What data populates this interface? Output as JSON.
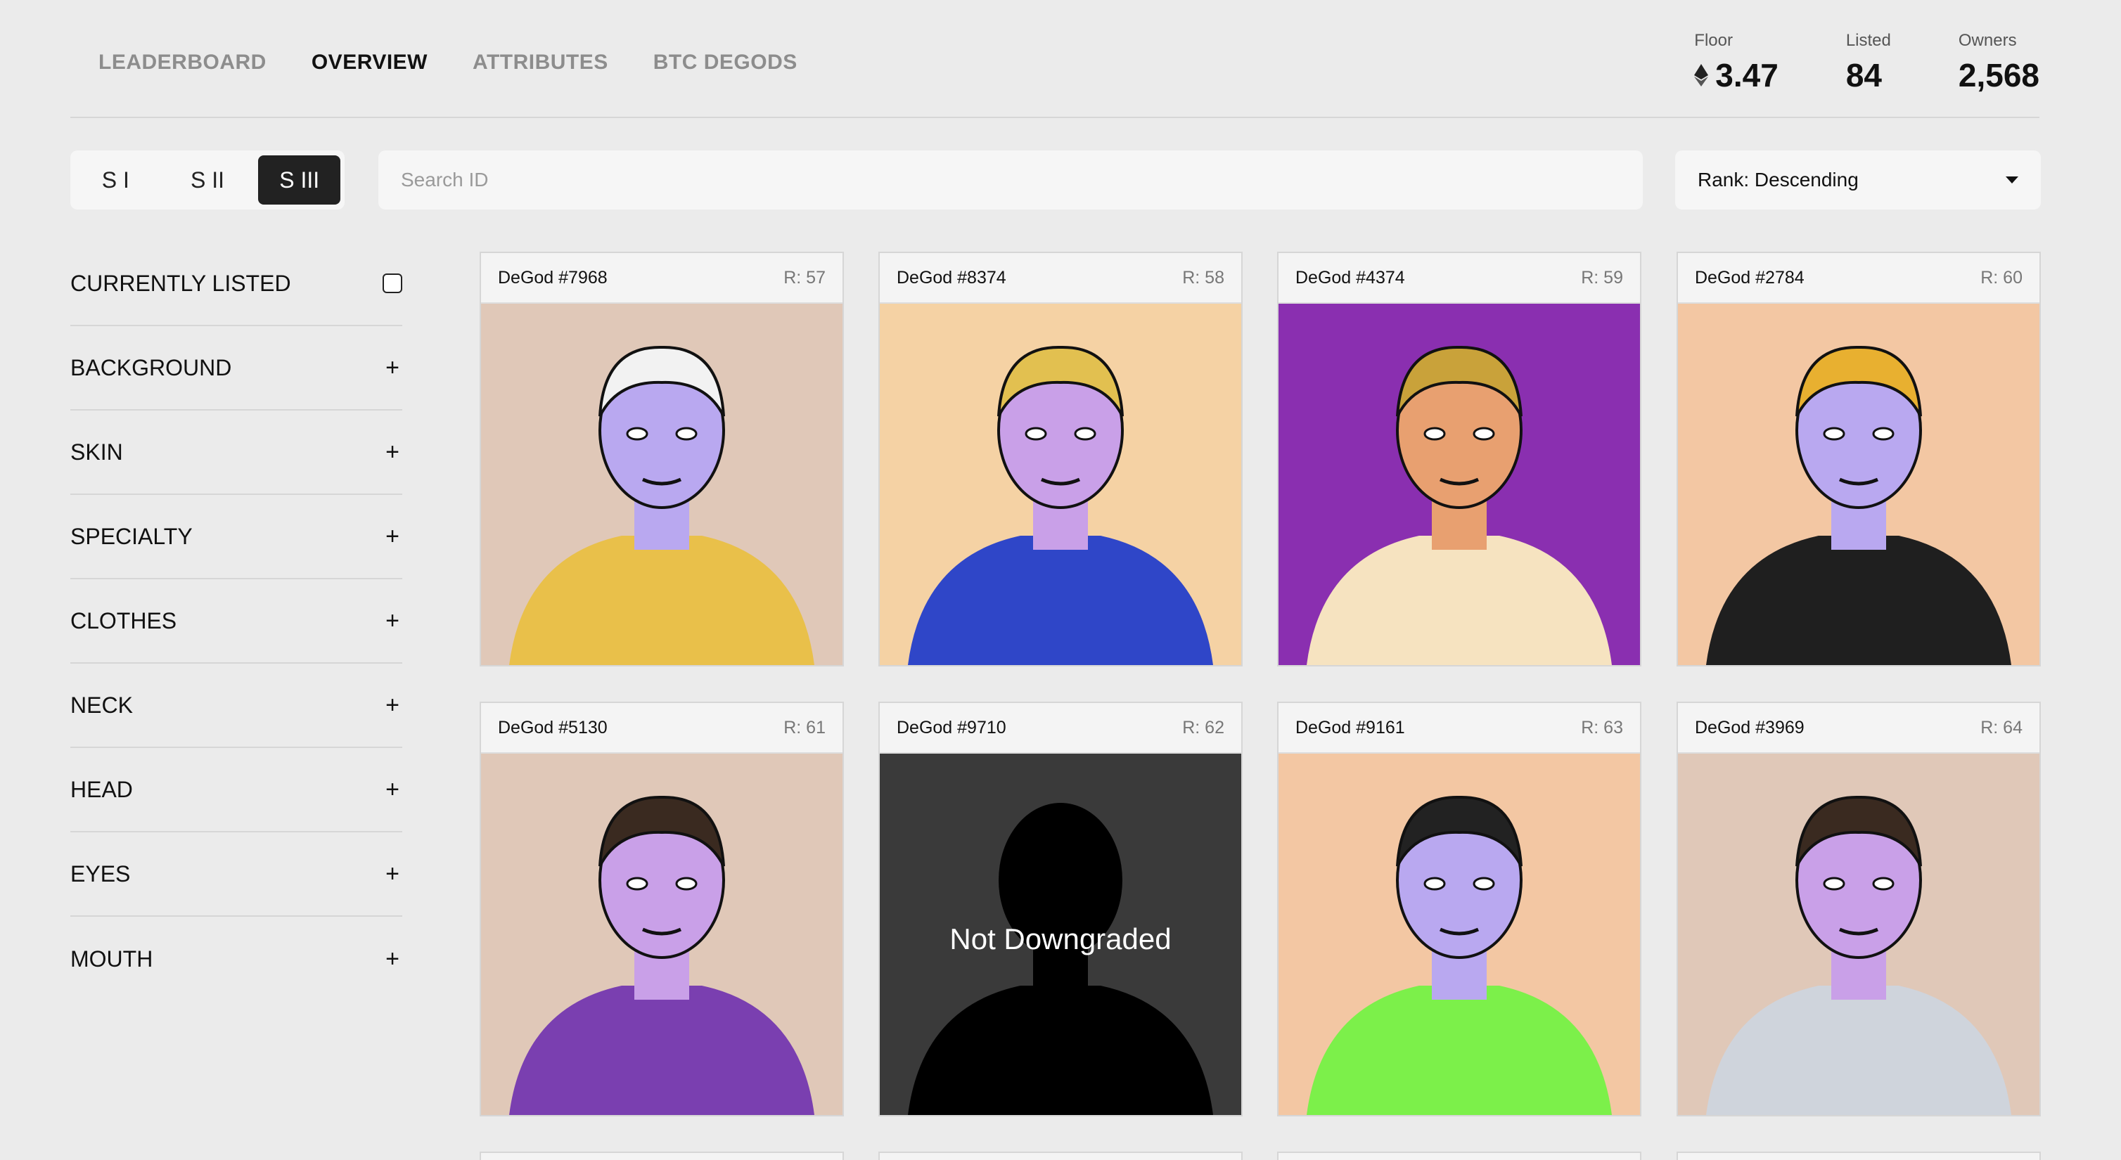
{
  "nav": {
    "tabs": [
      {
        "label": "LEADERBOARD",
        "active": false
      },
      {
        "label": "OVERVIEW",
        "active": true
      },
      {
        "label": "ATTRIBUTES",
        "active": false
      },
      {
        "label": "BTC DEGODS",
        "active": false
      }
    ]
  },
  "stats": {
    "floor": {
      "label": "Floor",
      "value": "3.47",
      "icon": "ethereum-icon"
    },
    "listed": {
      "label": "Listed",
      "value": "84"
    },
    "owners": {
      "label": "Owners",
      "value": "2,568"
    }
  },
  "seasons": {
    "items": [
      {
        "label": "S I",
        "active": false
      },
      {
        "label": "S II",
        "active": false
      },
      {
        "label": "S III",
        "active": true
      }
    ]
  },
  "search": {
    "placeholder": "Search ID",
    "value": ""
  },
  "sort": {
    "selected": "Rank: Descending",
    "icon": "caret-down-icon"
  },
  "filters": {
    "currently_listed": {
      "label": "CURRENTLY LISTED",
      "checked": false
    },
    "groups": [
      {
        "label": "BACKGROUND",
        "icon": "plus-icon"
      },
      {
        "label": "SKIN",
        "icon": "plus-icon"
      },
      {
        "label": "SPECIALTY",
        "icon": "plus-icon"
      },
      {
        "label": "CLOTHES",
        "icon": "plus-icon"
      },
      {
        "label": "NECK",
        "icon": "plus-icon"
      },
      {
        "label": "HEAD",
        "icon": "plus-icon"
      },
      {
        "label": "EYES",
        "icon": "plus-icon"
      },
      {
        "label": "MOUTH",
        "icon": "plus-icon"
      }
    ]
  },
  "cards": [
    {
      "name": "DeGod #7968",
      "rank": "R: 57",
      "bg": "#e0c8b8"
    },
    {
      "name": "DeGod #8374",
      "rank": "R: 58",
      "bg": "#f5d2a4"
    },
    {
      "name": "DeGod #4374",
      "rank": "R: 59",
      "bg": "#8a2fb0"
    },
    {
      "name": "DeGod #2784",
      "rank": "R: 60",
      "bg": "#f3c7a3"
    },
    {
      "name": "DeGod #5130",
      "rank": "R: 61",
      "bg": "#e0c8b8"
    },
    {
      "name": "DeGod #9710",
      "rank": "R: 62",
      "bg": "#3a3a3a",
      "overlay": "Not Downgraded"
    },
    {
      "name": "DeGod #9161",
      "rank": "R: 63",
      "bg": "#f3c7a3"
    },
    {
      "name": "DeGod #3969",
      "rank": "R: 64",
      "bg": "#e0c8b8"
    }
  ]
}
